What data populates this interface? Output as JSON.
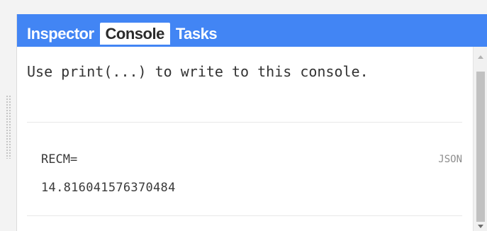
{
  "tabs": [
    {
      "label": "Inspector",
      "active": false
    },
    {
      "label": "Console",
      "active": true
    },
    {
      "label": "Tasks",
      "active": false
    }
  ],
  "console": {
    "intro": "Use print(...) to write to this console.",
    "entries": [
      {
        "label": "RECM=",
        "value": "14.816041576370484",
        "action": "JSON"
      }
    ]
  },
  "colors": {
    "tab_bar": "#4285f4",
    "active_tab_bg": "#ffffff",
    "panel_bg": "#ffffff"
  }
}
